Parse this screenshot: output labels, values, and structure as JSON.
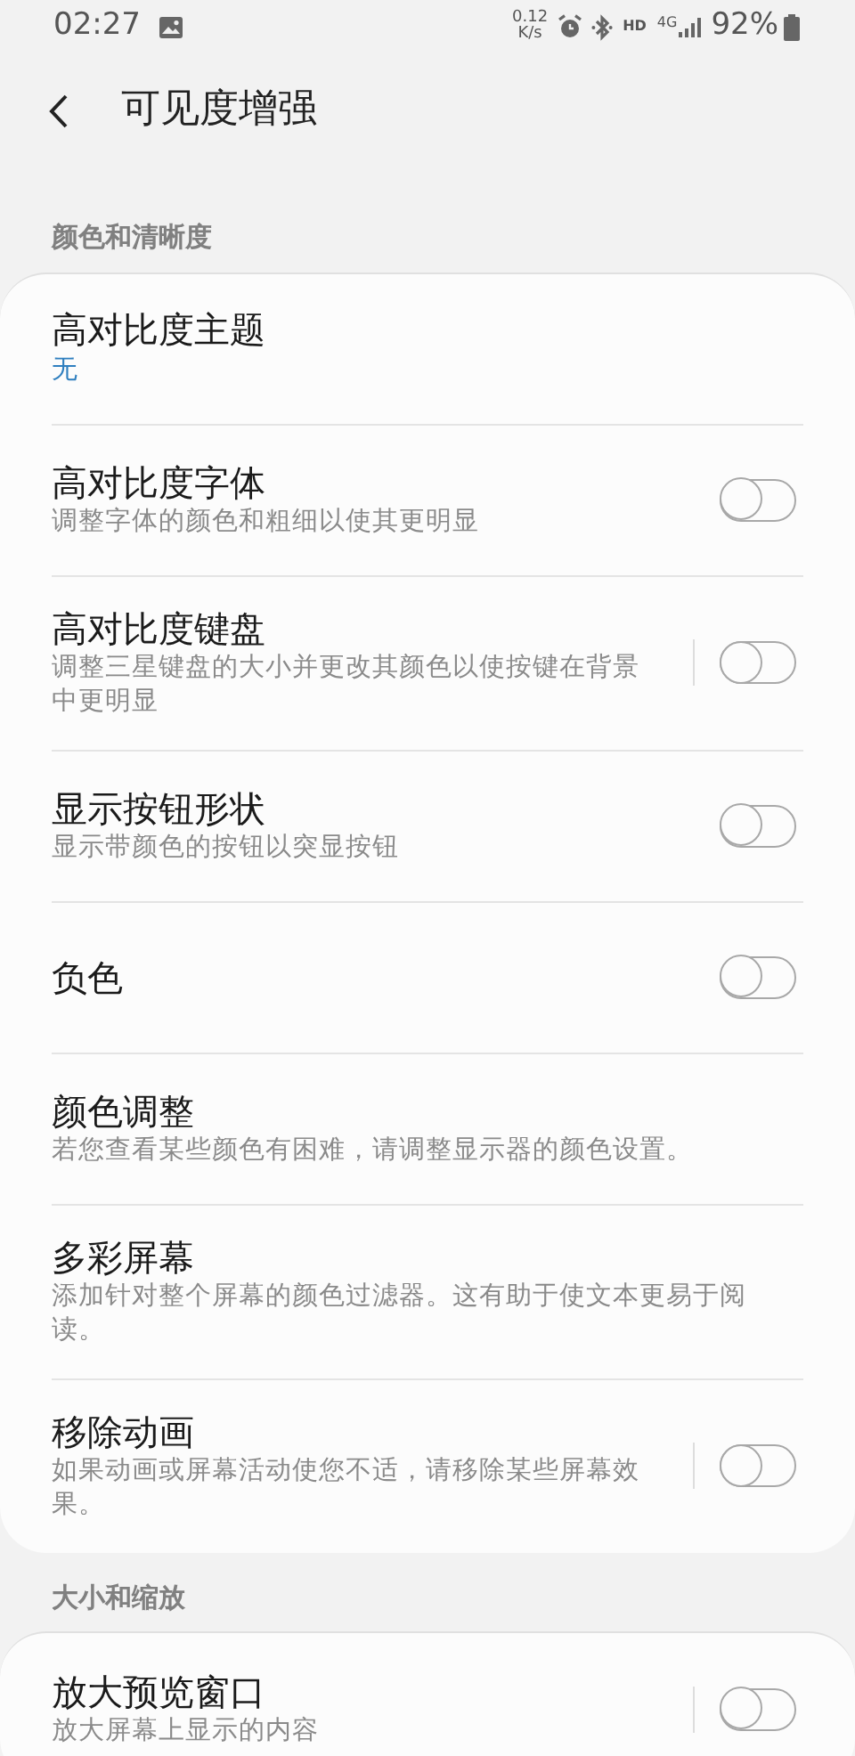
{
  "status_bar": {
    "time": "02:27",
    "net_speed": "0.12",
    "net_unit": "K/s",
    "hd": "HD",
    "network": "4G",
    "battery": "92%"
  },
  "header": {
    "title": "可见度增强"
  },
  "sections": [
    {
      "title": "颜色和清晰度",
      "items": [
        {
          "kind": "value",
          "title": "高对比度主题",
          "value": "无"
        },
        {
          "kind": "toggle",
          "title": "高对比度字体",
          "subtitle": "调整字体的颜色和粗细以使其更明显",
          "on": false
        },
        {
          "kind": "split-toggle",
          "title": "高对比度键盘",
          "subtitle": "调整三星键盘的大小并更改其颜色以使按键在背景中更明显",
          "on": false
        },
        {
          "kind": "toggle",
          "title": "显示按钮形状",
          "subtitle": "显示带颜色的按钮以突显按钮",
          "on": false
        },
        {
          "kind": "toggle",
          "title": "负色",
          "on": false
        },
        {
          "kind": "text",
          "title": "颜色调整",
          "subtitle": "若您查看某些颜色有困难，请调整显示器的颜色设置。"
        },
        {
          "kind": "text",
          "title": "多彩屏幕",
          "subtitle": "添加针对整个屏幕的颜色过滤器。这有助于使文本更易于阅读。"
        },
        {
          "kind": "split-toggle",
          "title": "移除动画",
          "subtitle": "如果动画或屏幕活动使您不适，请移除某些屏幕效果。",
          "on": false
        }
      ]
    },
    {
      "title": "大小和缩放",
      "items": [
        {
          "kind": "split-toggle",
          "title": "放大预览窗口",
          "subtitle": "放大屏幕上显示的内容",
          "on": false
        }
      ]
    }
  ]
}
